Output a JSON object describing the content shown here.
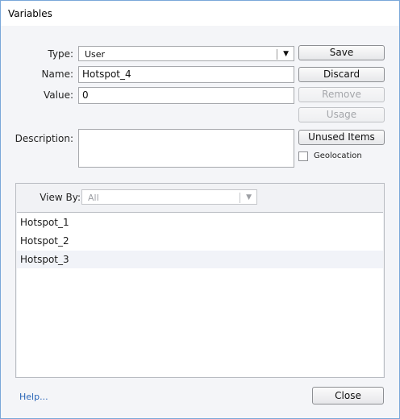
{
  "window": {
    "title": "Variables"
  },
  "form": {
    "type_label": "Type:",
    "type_value": "User",
    "name_label": "Name:",
    "name_value": "Hotspot_4",
    "value_label": "Value:",
    "value_value": "0",
    "description_label": "Description:",
    "description_value": ""
  },
  "buttons": {
    "save": "Save",
    "discard": "Discard",
    "remove": "Remove",
    "usage": "Usage",
    "unused_items": "Unused Items",
    "close": "Close"
  },
  "geolocation": {
    "label": "Geolocation",
    "checked": false
  },
  "view": {
    "label": "View By:",
    "value": "All",
    "items": [
      "Hotspot_1",
      "Hotspot_2",
      "Hotspot_3"
    ]
  },
  "footer": {
    "help": "Help..."
  },
  "colors": {
    "accent_border": "#7aa7d9",
    "link": "#2a66b8",
    "disabled_text": "#a4a6aa"
  }
}
